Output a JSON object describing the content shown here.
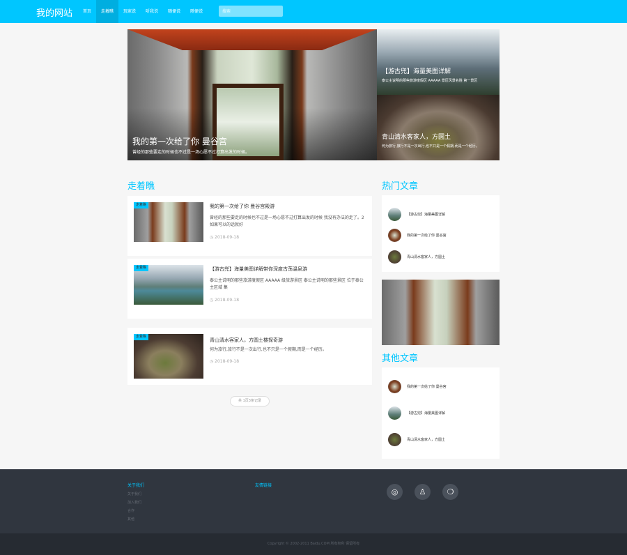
{
  "site": {
    "logo": "我的网站"
  },
  "nav": {
    "items": [
      {
        "label": "首页"
      },
      {
        "label": "走着瞧"
      },
      {
        "label": "玩家说"
      },
      {
        "label": "听我说"
      },
      {
        "label": "随便说"
      },
      {
        "label": "随便说"
      }
    ],
    "search_placeholder": "搜索"
  },
  "hero": {
    "main": {
      "title": "我的第一次给了你 曼谷宫",
      "desc": "曾经的那些要走的时候也不过是一场心愿不过打算出发的时候。"
    },
    "side_top": {
      "title": "【游古兜】海量美图详解",
      "desc": "泰公主说明的那些旅游度假区 AAAAA 景区风景名胜 第一景区"
    },
    "side_bottom": {
      "title": "青山清水客家人，方圆土",
      "desc": "何为旅行,旅行不是一次出行,也不只是一个假期,而是一个经历。"
    }
  },
  "main": {
    "section_title": "走着瞧",
    "cards": [
      {
        "tag": "走着瞧",
        "title": "我的第一次给了你 曼谷宫殿游",
        "desc": "曾经的那些要走的时候也不过是一场心愿不过打算出发的时候 我没有办法的走了。2 如果可以的话就好",
        "date": "◷ 2018-09-18"
      },
      {
        "tag": "走着瞧",
        "title": "【游古兜】海量美图详解带你深度古荡温泉游",
        "desc": "泰公主说明的那些旅游度假区 AAAAA 级旅游景区 泰公主说明的那些景区 位于泰公主区域 集",
        "date": "◷ 2018-09-18"
      },
      {
        "tag": "走着瞧",
        "title": "青山清水客家人，方圆土楼探奇游",
        "desc": "何为旅行,旅行不是一次出行,也不只是一个假期,而是一个经历。",
        "date": "◷ 2018-09-18"
      }
    ],
    "pager": "共 1页3条记录"
  },
  "sidebar": {
    "hot_title": "热门文章",
    "hot_items": [
      {
        "label": "【游古兜】海量美图详解"
      },
      {
        "label": "我的第一次给了你 曼谷宫"
      },
      {
        "label": "青山清水客家人，方圆土"
      }
    ],
    "other_title": "其他文章",
    "other_items": [
      {
        "label": "我的第一次给了你 曼谷宫"
      },
      {
        "label": "【游古兜】海量美图详解"
      },
      {
        "label": "青山清水客家人，方圆土"
      }
    ]
  },
  "footer": {
    "col1_title": "关于我们",
    "col1_links": [
      "关于我们",
      "加入我们",
      "合作",
      "其他"
    ],
    "col2_title": "友情链接",
    "social": [
      {
        "icon": "weibo-icon",
        "glyph": "◎"
      },
      {
        "icon": "qq-icon",
        "glyph": "♙"
      },
      {
        "icon": "wechat-icon",
        "glyph": "❍"
      }
    ],
    "copyright": "Copyright © 2002-2011 Baidu.COM 所有权利 保留所有"
  },
  "colors": {
    "accent": "#00c6ff",
    "footer_bg": "#30363f",
    "footer_bottom": "#262b32"
  }
}
